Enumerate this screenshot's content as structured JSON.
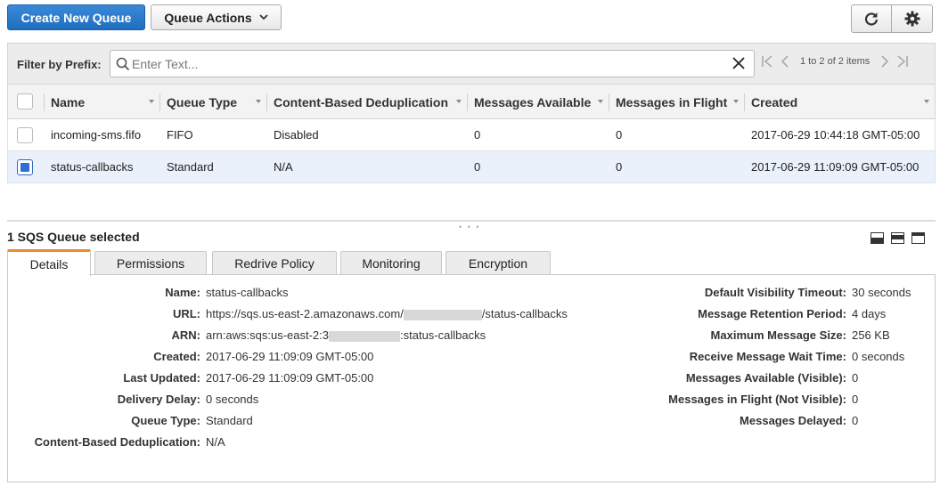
{
  "toolbar": {
    "create_label": "Create New Queue",
    "actions_label": "Queue Actions"
  },
  "filter": {
    "label": "Filter by Prefix:",
    "placeholder": "Enter Text...",
    "value": ""
  },
  "pager": {
    "text": "1 to 2 of 2 items"
  },
  "table": {
    "columns": [
      "Name",
      "Queue Type",
      "Content-Based Deduplication",
      "Messages Available",
      "Messages in Flight",
      "Created"
    ],
    "rows": [
      {
        "name": "incoming-sms.fifo",
        "type": "FIFO",
        "dedup": "Disabled",
        "available": "0",
        "in_flight": "0",
        "created": "2017-06-29 10:44:18 GMT-05:00",
        "selected": false
      },
      {
        "name": "status-callbacks",
        "type": "Standard",
        "dedup": "N/A",
        "available": "0",
        "in_flight": "0",
        "created": "2017-06-29 11:09:09 GMT-05:00",
        "selected": true
      }
    ]
  },
  "details": {
    "selected_count": "1 SQS Queue selected",
    "tabs": [
      "Details",
      "Permissions",
      "Redrive Policy",
      "Monitoring",
      "Encryption"
    ],
    "active_tab": "Details",
    "left": {
      "name_k": "Name:",
      "name_v": "status-callbacks",
      "url_k": "URL:",
      "url_v_pre": "https://sqs.us-east-2.amazonaws.com/",
      "url_v_post": "/status-callbacks",
      "arn_k": "ARN:",
      "arn_v_pre": "arn:aws:sqs:us-east-2:",
      "arn_v_mid": "3",
      "arn_v_post": ":status-callbacks",
      "created_k": "Created:",
      "created_v": "2017-06-29 11:09:09 GMT-05:00",
      "updated_k": "Last Updated:",
      "updated_v": "2017-06-29 11:09:09 GMT-05:00",
      "delay_k": "Delivery Delay:",
      "delay_v": "0 seconds",
      "qtype_k": "Queue Type:",
      "qtype_v": "Standard",
      "dedup_k": "Content-Based Deduplication:",
      "dedup_v": "N/A"
    },
    "right": {
      "vis_k": "Default Visibility Timeout:",
      "vis_v": "30 seconds",
      "ret_k": "Message Retention Period:",
      "ret_v": "4 days",
      "max_k": "Maximum Message Size:",
      "max_v": "256 KB",
      "wait_k": "Receive Message Wait Time:",
      "wait_v": "0 seconds",
      "avail_k": "Messages Available (Visible):",
      "avail_v": "0",
      "flight_k": "Messages in Flight (Not Visible):",
      "flight_v": "0",
      "delayed_k": "Messages Delayed:",
      "delayed_v": "0"
    }
  }
}
